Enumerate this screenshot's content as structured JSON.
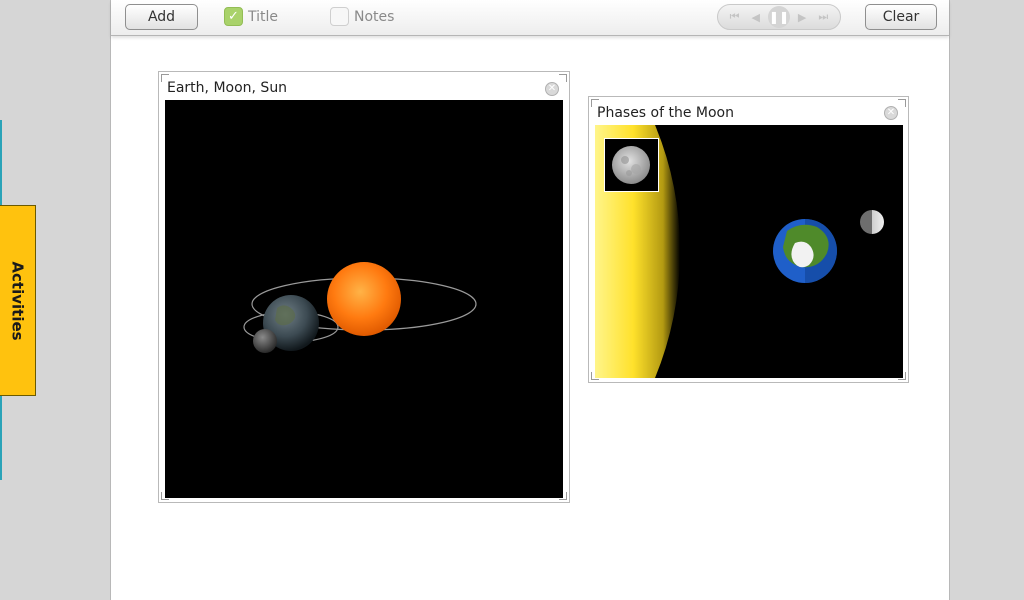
{
  "toolbar": {
    "add_label": "Add",
    "title_check": {
      "label": "Title",
      "checked": true
    },
    "notes_check": {
      "label": "Notes",
      "checked": false
    },
    "player": {
      "first_icon": "skip-first-icon",
      "prev_icon": "step-back-icon",
      "pause_icon": "pause-icon",
      "next_icon": "step-forward-icon",
      "last_icon": "skip-last-icon"
    },
    "clear_label": "Clear"
  },
  "sidebar": {
    "activities_label": "Activities"
  },
  "panels": [
    {
      "title": "Earth, Moon, Sun"
    },
    {
      "title": "Phases of the Moon"
    }
  ],
  "colors": {
    "activities_tab": "#ffc20e",
    "checkbox_checked": "#a9d26a",
    "view_background": "#000000",
    "sun": "#ff7a10",
    "earth_ocean": "#1f5fc9",
    "earth_land": "#4f8a2a"
  }
}
